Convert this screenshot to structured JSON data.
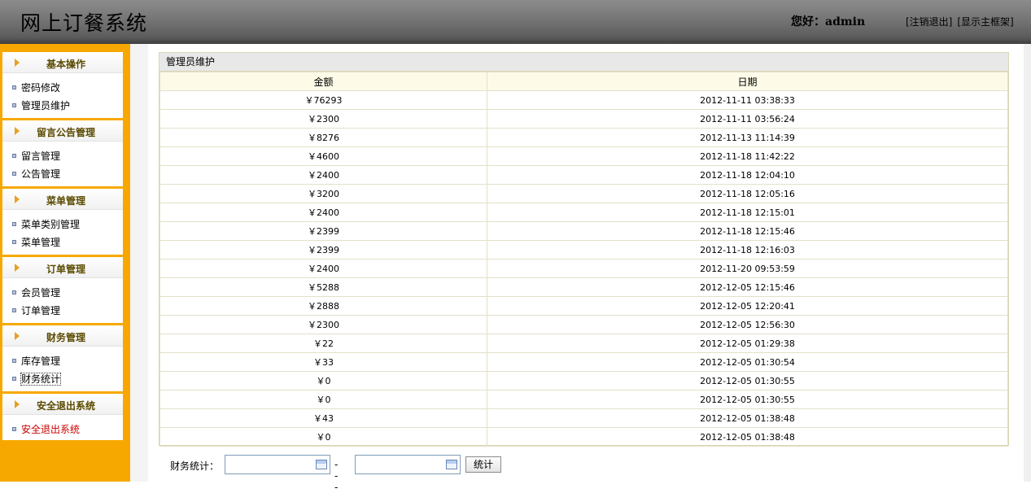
{
  "header": {
    "title": "网上订餐系统",
    "greeting": "您好：admin",
    "logout_link": "[注销退出]",
    "frame_link": "[显示主框架]"
  },
  "sidebar": {
    "groups": [
      {
        "title": "基本操作",
        "items": [
          "密码修改",
          "管理员维护"
        ]
      },
      {
        "title": "留言公告管理",
        "items": [
          "留言管理",
          "公告管理"
        ]
      },
      {
        "title": "菜单管理",
        "items": [
          "菜单类别管理",
          "菜单管理"
        ]
      },
      {
        "title": "订单管理",
        "items": [
          "会员管理",
          "订单管理"
        ]
      },
      {
        "title": "财务管理",
        "items": [
          "库存管理",
          "财务统计"
        ]
      },
      {
        "title": "安全退出系统",
        "items": [
          "安全退出系统"
        ]
      }
    ]
  },
  "panel": {
    "title": "管理员维护",
    "columns": [
      "金额",
      "日期"
    ],
    "rows": [
      [
        "￥76293",
        "2012-11-11 03:38:33"
      ],
      [
        "￥2300",
        "2012-11-11 03:56:24"
      ],
      [
        "￥8276",
        "2012-11-13 11:14:39"
      ],
      [
        "￥4600",
        "2012-11-18 11:42:22"
      ],
      [
        "￥2400",
        "2012-11-18 12:04:10"
      ],
      [
        "￥3200",
        "2012-11-18 12:05:16"
      ],
      [
        "￥2400",
        "2012-11-18 12:15:01"
      ],
      [
        "￥2399",
        "2012-11-18 12:15:46"
      ],
      [
        "￥2399",
        "2012-11-18 12:16:03"
      ],
      [
        "￥2400",
        "2012-11-20 09:53:59"
      ],
      [
        "￥5288",
        "2012-12-05 12:15:46"
      ],
      [
        "￥2888",
        "2012-12-05 12:20:41"
      ],
      [
        "￥2300",
        "2012-12-05 12:56:30"
      ],
      [
        "￥22",
        "2012-12-05 01:29:38"
      ],
      [
        "￥33",
        "2012-12-05 01:30:54"
      ],
      [
        "￥0",
        "2012-12-05 01:30:55"
      ],
      [
        "￥0",
        "2012-12-05 01:30:55"
      ],
      [
        "￥43",
        "2012-12-05 01:38:48"
      ],
      [
        "￥0",
        "2012-12-05 01:38:48"
      ]
    ]
  },
  "filter": {
    "label": "财务统计：",
    "start_value": "",
    "end_value": "",
    "separator": "---",
    "button": "统计"
  },
  "colors": {
    "sidebar_bg": "#f7a800",
    "logout_item": "#cc0000"
  }
}
